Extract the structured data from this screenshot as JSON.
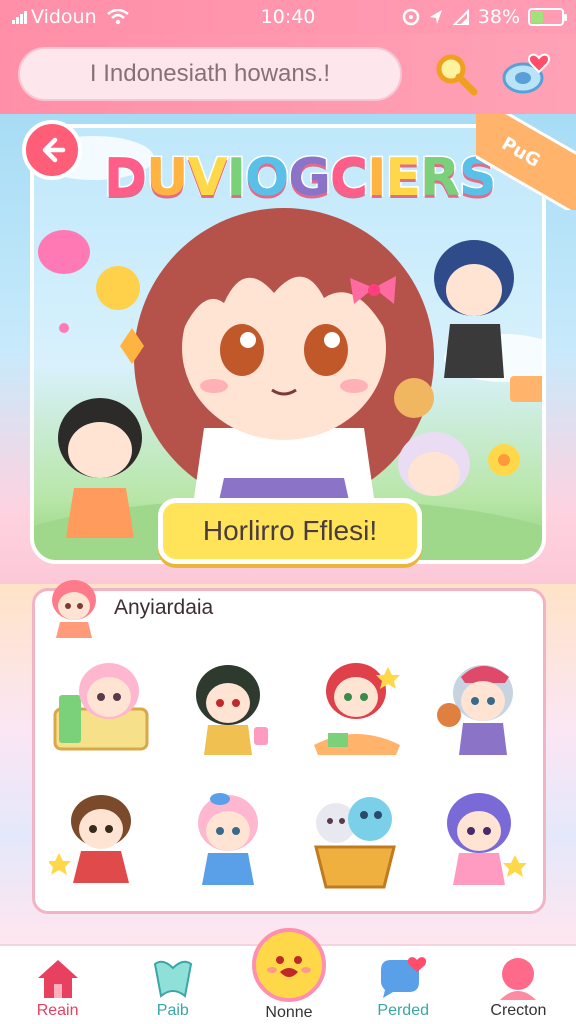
{
  "status_bar": {
    "carrier": "Vidoun",
    "time": "10:40",
    "battery_percent": "38%",
    "battery_level": 0.38
  },
  "search": {
    "value": "I Indonesiath howans.!"
  },
  "icons": {
    "search": "search-icon",
    "favorite": "heart-icon",
    "back": "back-arrow-icon"
  },
  "hero": {
    "title": "DUVIOGCIERS",
    "cta_label": "Horlirro Fflesi!",
    "ribbon_text": "PuG"
  },
  "gallery": {
    "title": "Anyiardaia",
    "items": [
      "character-1",
      "character-2",
      "character-3",
      "character-4",
      "character-5",
      "character-6",
      "character-7",
      "character-8"
    ]
  },
  "nav": {
    "items": [
      {
        "label": "Reain",
        "icon": "home-icon",
        "color": "#e8405f"
      },
      {
        "label": "Paib",
        "icon": "bookmark-icon",
        "color": "#3aa6a6"
      },
      {
        "label": "Perded",
        "icon": "chat-icon",
        "color": "#3aa6a6"
      },
      {
        "label": "Crecton",
        "icon": "profile-icon",
        "color": "#333333"
      }
    ],
    "center_label": "Nonne"
  },
  "colors": {
    "accent": "#ff8fa8",
    "cta": "#ffe45a",
    "back_button": "#ff5d78"
  }
}
